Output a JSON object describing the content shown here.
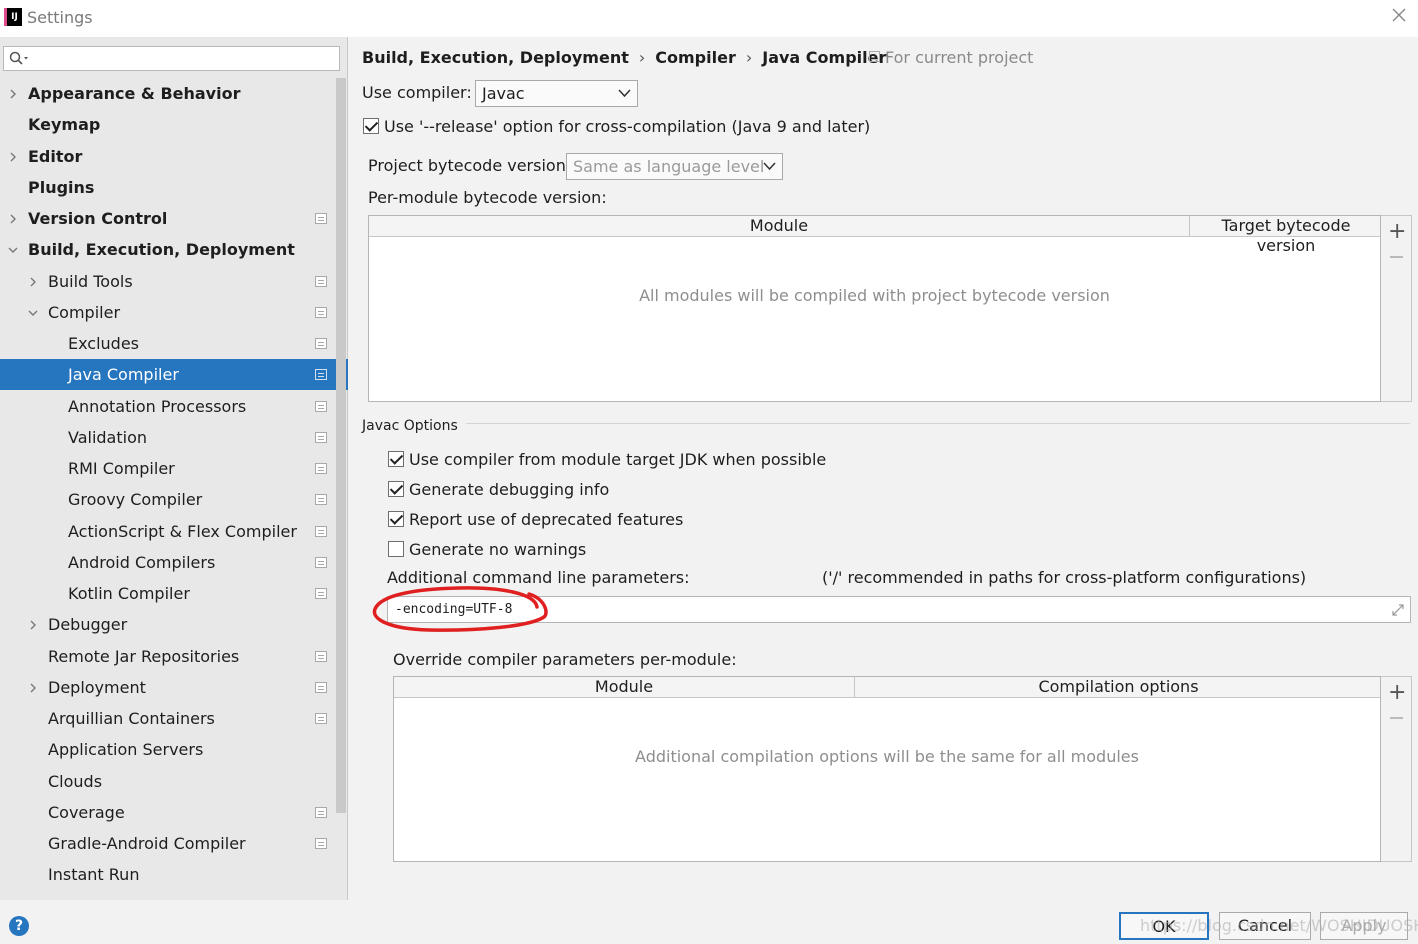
{
  "window": {
    "title": "Settings",
    "app_icon": "intellij-icon"
  },
  "sidebar": {
    "items": [
      {
        "label": "Appearance & Behavior",
        "level": 0,
        "expandable": true,
        "expanded": false,
        "bold": true,
        "project_icon": false
      },
      {
        "label": "Keymap",
        "level": 0,
        "expandable": false,
        "bold": true,
        "project_icon": false
      },
      {
        "label": "Editor",
        "level": 0,
        "expandable": true,
        "expanded": false,
        "bold": true,
        "project_icon": false
      },
      {
        "label": "Plugins",
        "level": 0,
        "expandable": false,
        "bold": true,
        "project_icon": false
      },
      {
        "label": "Version Control",
        "level": 0,
        "expandable": true,
        "expanded": false,
        "bold": true,
        "project_icon": true
      },
      {
        "label": "Build, Execution, Deployment",
        "level": 0,
        "expandable": true,
        "expanded": true,
        "bold": true,
        "project_icon": false
      },
      {
        "label": "Build Tools",
        "level": 1,
        "expandable": true,
        "expanded": false,
        "project_icon": true
      },
      {
        "label": "Compiler",
        "level": 1,
        "expandable": true,
        "expanded": true,
        "project_icon": true
      },
      {
        "label": "Excludes",
        "level": 2,
        "expandable": false,
        "project_icon": true
      },
      {
        "label": "Java Compiler",
        "level": 2,
        "expandable": false,
        "project_icon": true,
        "selected": true
      },
      {
        "label": "Annotation Processors",
        "level": 2,
        "expandable": false,
        "project_icon": true
      },
      {
        "label": "Validation",
        "level": 2,
        "expandable": false,
        "project_icon": true
      },
      {
        "label": "RMI Compiler",
        "level": 2,
        "expandable": false,
        "project_icon": true
      },
      {
        "label": "Groovy Compiler",
        "level": 2,
        "expandable": false,
        "project_icon": true
      },
      {
        "label": "ActionScript & Flex Compiler",
        "level": 2,
        "expandable": false,
        "project_icon": true
      },
      {
        "label": "Android Compilers",
        "level": 2,
        "expandable": false,
        "project_icon": true
      },
      {
        "label": "Kotlin Compiler",
        "level": 2,
        "expandable": false,
        "project_icon": true
      },
      {
        "label": "Debugger",
        "level": 1,
        "expandable": true,
        "expanded": false,
        "project_icon": false
      },
      {
        "label": "Remote Jar Repositories",
        "level": 1,
        "expandable": false,
        "project_icon": true
      },
      {
        "label": "Deployment",
        "level": 1,
        "expandable": true,
        "expanded": false,
        "project_icon": true
      },
      {
        "label": "Arquillian Containers",
        "level": 1,
        "expandable": false,
        "project_icon": true
      },
      {
        "label": "Application Servers",
        "level": 1,
        "expandable": false,
        "project_icon": false
      },
      {
        "label": "Clouds",
        "level": 1,
        "expandable": false,
        "project_icon": false
      },
      {
        "label": "Coverage",
        "level": 1,
        "expandable": false,
        "project_icon": true
      },
      {
        "label": "Gradle-Android Compiler",
        "level": 1,
        "expandable": false,
        "project_icon": true
      },
      {
        "label": "Instant Run",
        "level": 1,
        "expandable": false,
        "project_icon": false
      }
    ]
  },
  "breadcrumb": {
    "parts": [
      "Build, Execution, Deployment",
      "Compiler",
      "Java Compiler"
    ],
    "separator": "›",
    "scope": "For current project"
  },
  "compiler": {
    "use_label": "Use compiler:",
    "use_value": "Javac",
    "release_label": "Use '--release' option for cross-compilation (Java 9 and later)",
    "release_checked": true
  },
  "bytecode": {
    "project_label": "Project bytecode version:",
    "project_value": "Same as language level",
    "per_module_label": "Per-module bytecode version:",
    "col_module": "Module",
    "col_target": "Target bytecode version",
    "empty_text": "All modules will be compiled with project bytecode version"
  },
  "javac": {
    "section_title": "Javac Options",
    "options": [
      {
        "label": "Use compiler from module target JDK when possible",
        "checked": true
      },
      {
        "label": "Generate debugging info",
        "checked": true
      },
      {
        "label": "Report use of deprecated features",
        "checked": true
      },
      {
        "label": "Generate no warnings",
        "checked": false
      }
    ],
    "params_label": "Additional command line parameters:",
    "params_hint": "('/' recommended in paths for cross-platform configurations)",
    "params_value": "-encoding=UTF-8",
    "override_label": "Override compiler parameters per-module:",
    "col_module": "Module",
    "col_options": "Compilation options",
    "override_empty": "Additional compilation options will be the same for all modules"
  },
  "footer": {
    "help": "?",
    "ok": "OK",
    "cancel": "Cancel",
    "apply": "Apply",
    "watermark": "https://blog.csdn.net/WOSHIDUOSHA"
  },
  "colors": {
    "selection": "#2675bf",
    "annotation_circle": "#e02020"
  }
}
